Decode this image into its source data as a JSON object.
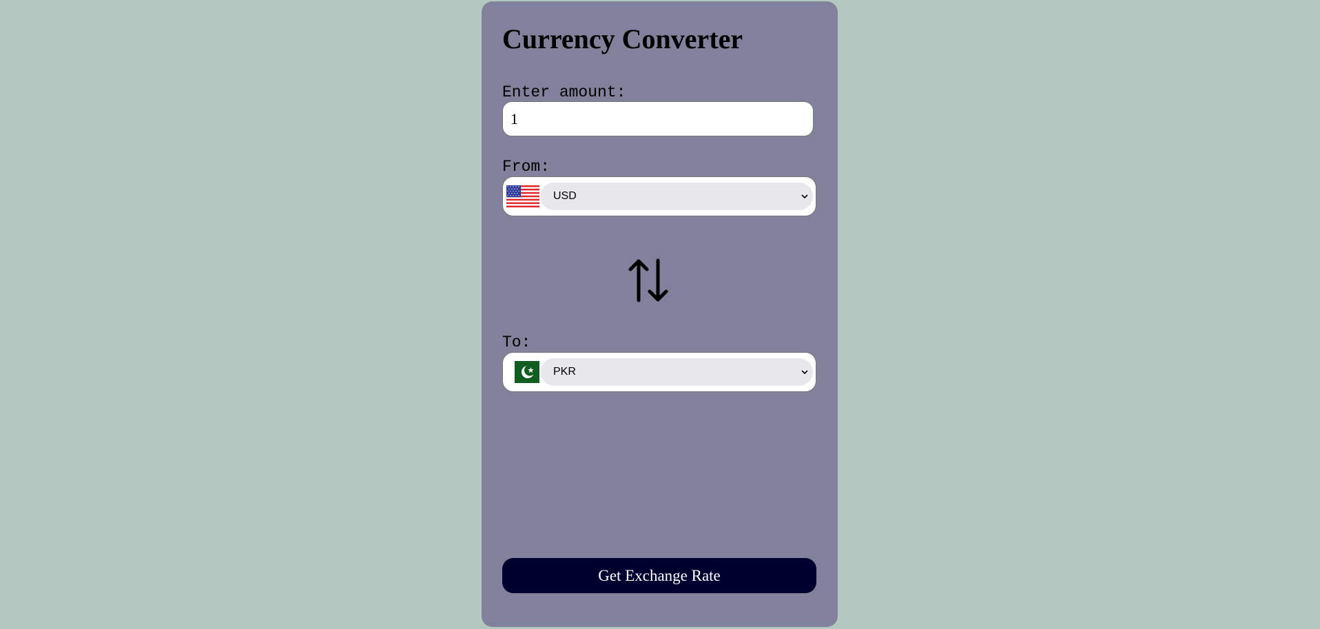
{
  "app": {
    "title": "Currency Converter"
  },
  "amount": {
    "label": "Enter amount:",
    "value": "1"
  },
  "from": {
    "label": "From:",
    "currency": "USD",
    "flag_icon": "us-flag-icon"
  },
  "swap": {
    "icon": "swap-arrows-icon"
  },
  "to": {
    "label": "To:",
    "currency": "PKR",
    "flag_icon": "pk-flag-icon"
  },
  "actions": {
    "exchange_label": "Get Exchange Rate"
  },
  "colors": {
    "page_background": "#b4c7c1",
    "card_background": "#82819b",
    "button_background": "#00002e",
    "button_text": "#ffffff",
    "select_background": "#e8e7eb"
  }
}
